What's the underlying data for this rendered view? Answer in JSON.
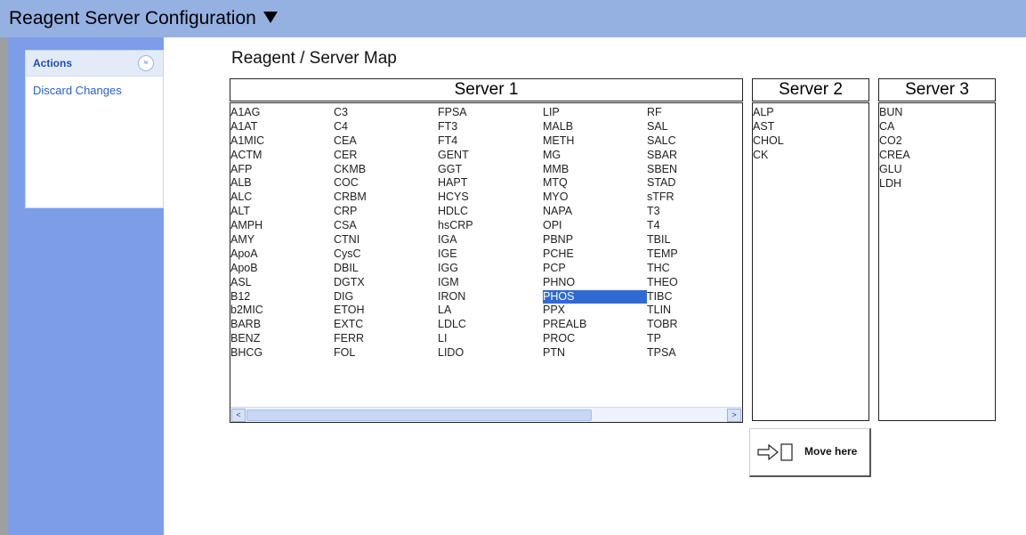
{
  "header": {
    "title": "Reagent Server Configuration"
  },
  "sidebar": {
    "panel_title": "Actions",
    "collapse_glyph": "≈",
    "items": [
      "Discard Changes"
    ]
  },
  "main": {
    "title": "Reagent / Server Map",
    "servers": [
      {
        "name": "Server 1",
        "columns": [
          [
            "A1AG",
            "A1AT",
            "A1MIC",
            "ACTM",
            "AFP",
            "ALB",
            "ALC",
            "ALT",
            "AMPH",
            "AMY",
            "ApoA",
            "ApoB",
            "ASL",
            "B12",
            "b2MIC",
            "BARB",
            "BENZ",
            "BHCG"
          ],
          [
            "C3",
            "C4",
            "CEA",
            "CER",
            "CKMB",
            "COC",
            "CRBM",
            "CRP",
            "CSA",
            "CTNI",
            "CysC",
            "DBIL",
            "DGTX",
            "DIG",
            "ETOH",
            "EXTC",
            "FERR",
            "FOL"
          ],
          [
            "FPSA",
            "FT3",
            "FT4",
            "GENT",
            "GGT",
            "HAPT",
            "HCYS",
            "HDLC",
            "hsCRP",
            "IGA",
            "IGE",
            "IGG",
            "IGM",
            "IRON",
            "LA",
            "LDLC",
            "LI",
            "LIDO"
          ],
          [
            "LIP",
            "MALB",
            "METH",
            "MG",
            "MMB",
            "MTQ",
            "MYO",
            "NAPA",
            "OPI",
            "PBNP",
            "PCHE",
            "PCP",
            "PHNO",
            "PHOS",
            "PPX",
            "PREALB",
            "PROC",
            "PTN"
          ],
          [
            "RF",
            "SAL",
            "SALC",
            "SBAR",
            "SBEN",
            "STAD",
            "sTFR",
            "T3",
            "T4",
            "TBIL",
            "TEMP",
            "THC",
            "THEO",
            "TIBC",
            "TLIN",
            "TOBR",
            "TP",
            "TPSA"
          ]
        ],
        "selected": "PHOS"
      },
      {
        "name": "Server 2",
        "items": [
          "ALP",
          "AST",
          "CHOL",
          "CK"
        ]
      },
      {
        "name": "Server 3",
        "items": [
          "BUN",
          "CA",
          "CO2",
          "CREA",
          "GLU",
          "LDH"
        ]
      }
    ],
    "move_button_label": "Move here",
    "scroll_left_glyph": "<",
    "scroll_right_glyph": ">"
  },
  "colors": {
    "title_bar": "#95b1e2",
    "sidebar": "#7c9ee8",
    "selection": "#2f6ad4",
    "link": "#2a5fc8"
  },
  "icons": {
    "dropdown": "triangle-down-icon",
    "collapse": "double-chevron-up-icon",
    "move": "arrow-right-to-box-icon"
  }
}
